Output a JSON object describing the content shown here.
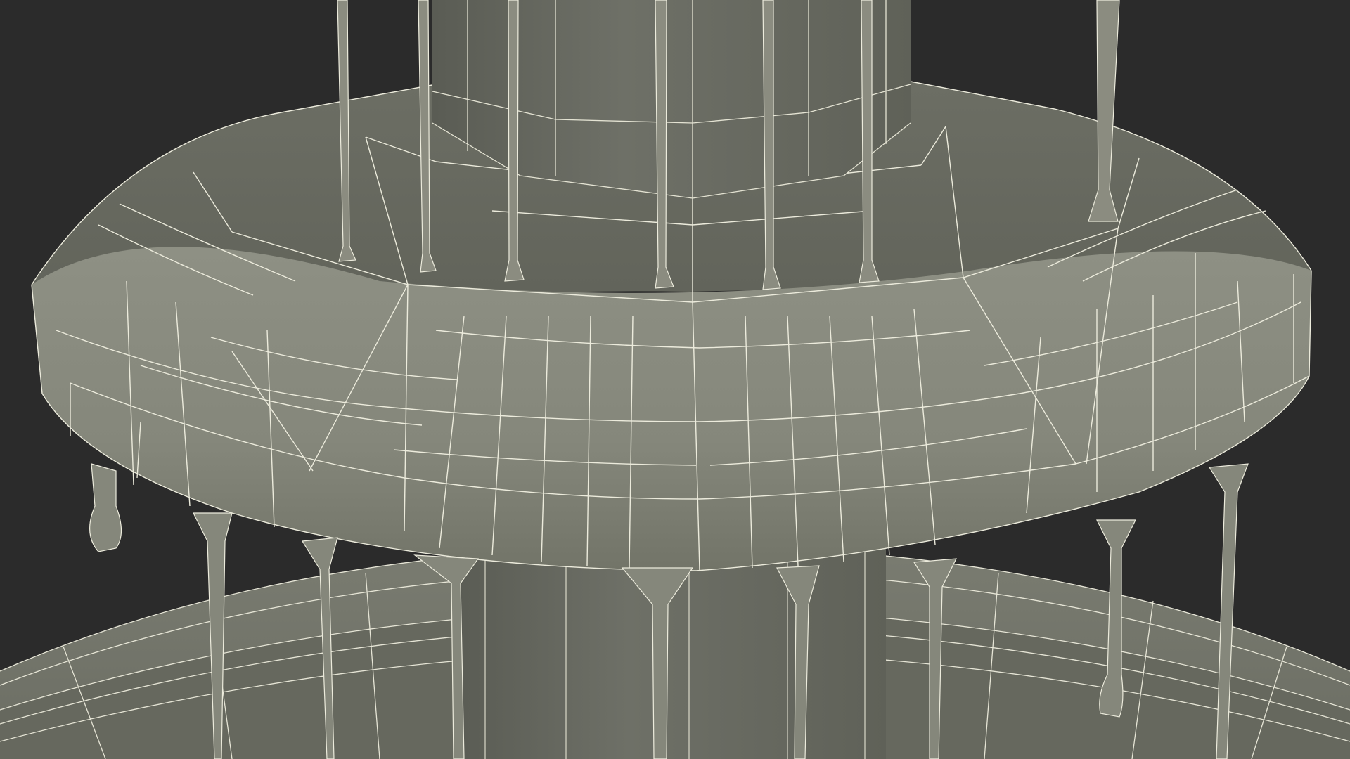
{
  "scene": {
    "subject": "fountain-wireframe-render",
    "colors": {
      "background": "#2b2b2b",
      "surface_light": "#8a8b7f",
      "surface_mid": "#74766b",
      "surface_dark": "#5d5f56",
      "wire": "#ecebdc"
    }
  }
}
